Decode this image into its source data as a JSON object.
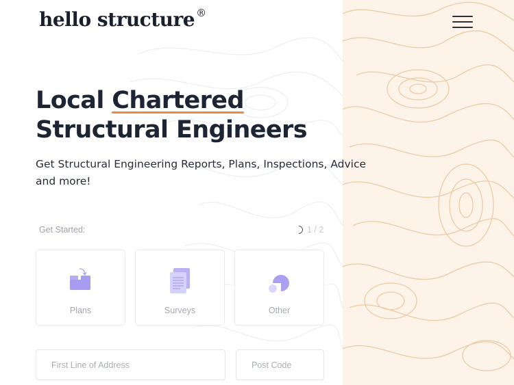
{
  "header": {
    "logo_text": "hello structure",
    "logo_mark": "®",
    "menu_icon": "hamburger-menu-icon"
  },
  "hero": {
    "title_line1_start": "Local ",
    "title_highlight": "Chartered",
    "title_line2": "Structural Engineers",
    "subtitle": "Get Structural Engineering Reports, Plans, Inspections, Advice and more!",
    "accent_color": "#f0883a"
  },
  "form": {
    "get_started_label": "Get Started:",
    "step_text": "1 / 2",
    "options": [
      {
        "label": "Plans",
        "icon": "plans-icon"
      },
      {
        "label": "Surveys",
        "icon": "survey-document-icon"
      },
      {
        "label": "Other",
        "icon": "other-shapes-icon"
      }
    ],
    "address_placeholder": "First Line of Address",
    "postcode_placeholder": "Post Code"
  },
  "colors": {
    "panel_bg": "#fdf3e8",
    "topo_lines": "#e9c9a3",
    "icon_purple": "#a89cf0"
  }
}
